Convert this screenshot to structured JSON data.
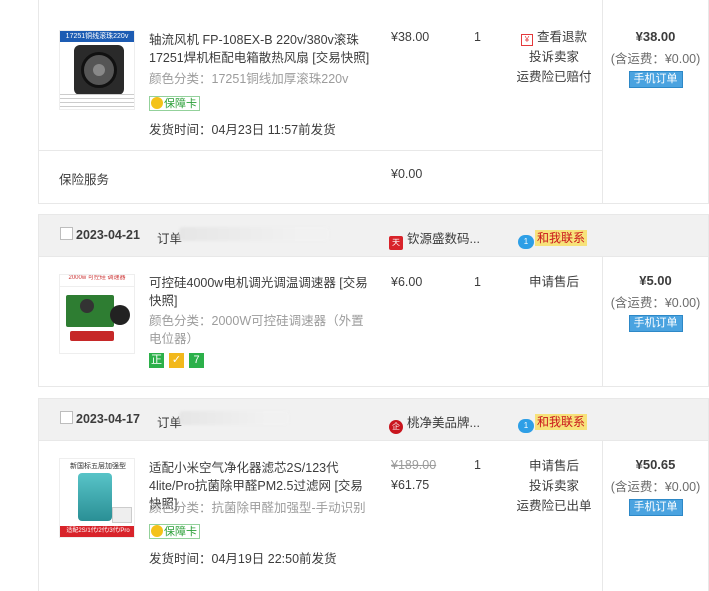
{
  "order1": {
    "item": {
      "title": "轴流风机 FP-108EX-B 220v/380v滚珠 17251焊机柜配电箱散热风扇 [交易快照]",
      "sku_label": "颜色分类：",
      "sku_value": "17251铜线加厚滚珠220v",
      "badge": "保障卡",
      "ship_time": "发货时间：04月23日 11:57前发货",
      "price": "¥38.00",
      "qty": "1",
      "ops": [
        "查看退款",
        "投诉卖家",
        "运费险已赔付"
      ],
      "total": "¥38.00",
      "fee": "(含运费：¥0.00)",
      "mobile_btn": "手机订单",
      "thumb_text": "17251铜线滚珠220v"
    },
    "service": {
      "label": "保险服务",
      "price": "¥0.00"
    }
  },
  "order2": {
    "header": {
      "date": "2023-04-21",
      "order_label": "订单",
      "shop": "钦源盛数码...",
      "contact": "和我联系"
    },
    "item": {
      "title": "可控硅4000w电机调光调温调速器 [交易快照]",
      "sku_label": "颜色分类：",
      "sku_value": "2000W可控硅调速器（外置电位器）",
      "price": "¥6.00",
      "qty": "1",
      "ops": [
        "申请售后"
      ],
      "total": "¥5.00",
      "fee": "(含运费：¥0.00)",
      "mobile_btn": "手机订单",
      "icons": [
        "正",
        "",
        "7"
      ]
    }
  },
  "order3": {
    "header": {
      "date": "2023-04-17",
      "order_label": "订单",
      "shop": "桃净美品牌...",
      "contact": "和我联系"
    },
    "item": {
      "title": "适配小米空气净化器滤芯2S/123代4lite/Pro抗菌除甲醛PM2.5过滤网 [交易快照]",
      "sku_label": "颜色分类：",
      "sku_value": "抗菌除甲醛加强型-手动识别",
      "badge": "保障卡",
      "ship_time": "发货时间：04月19日 22:50前发货",
      "price_old": "¥189.00",
      "price": "¥61.75",
      "qty": "1",
      "ops": [
        "申请售后",
        "投诉卖家",
        "运费险已出单"
      ],
      "total": "¥50.65",
      "fee": "(含运费：¥0.00)",
      "mobile_btn": "手机订单",
      "thumb_text": "新国标五层加强型",
      "thumb_foot": "适配2S/1代/2代/3代/Pro"
    }
  }
}
